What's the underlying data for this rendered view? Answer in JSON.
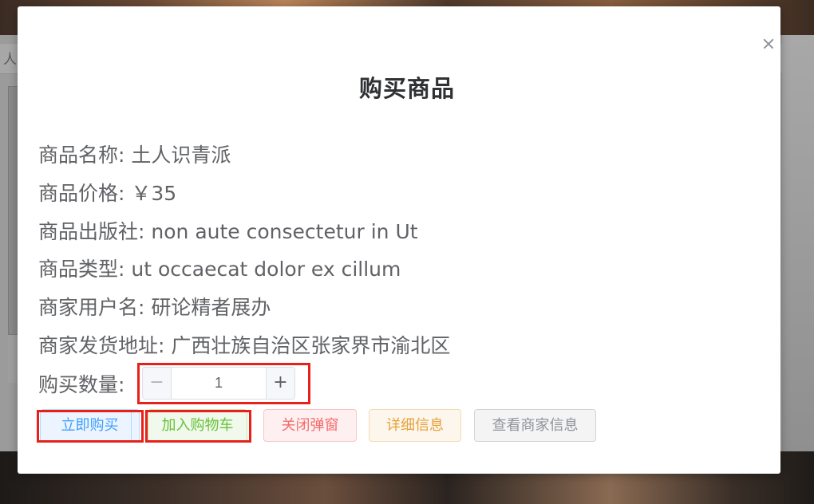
{
  "background": {
    "nav_fragment": "人关"
  },
  "dialog": {
    "title": "购买商品",
    "fields": [
      {
        "label": "商品名称:",
        "value": "土人识青派"
      },
      {
        "label": "商品价格:",
        "value": "￥35"
      },
      {
        "label": "商品出版社:",
        "value": "non aute consectetur in Ut"
      },
      {
        "label": "商品类型:",
        "value": "ut occaecat dolor ex cillum"
      },
      {
        "label": "商家用户名:",
        "value": "研论精者展办"
      }
    ],
    "address": {
      "label": "商家发货地址:",
      "value": "广西壮族自治区张家界市渝北区"
    },
    "quantity": {
      "label": "购买数量:",
      "value": "1",
      "minus": "−",
      "plus": "+"
    },
    "buttons": {
      "buy_now": "立即购买",
      "add_to_cart": "加入购物车",
      "close": "关闭弹窗",
      "details": "详细信息",
      "view_seller": "查看商家信息"
    }
  },
  "colors": {
    "primary": "#409eff",
    "success": "#67c23a",
    "danger": "#f56c6c",
    "warning": "#e6a23c",
    "info": "#909399",
    "highlight": "#e8201a"
  },
  "icons": {
    "close": "close-icon"
  }
}
